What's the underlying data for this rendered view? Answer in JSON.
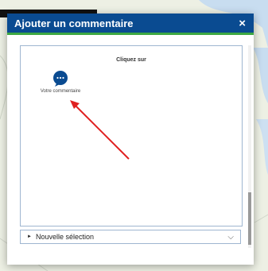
{
  "dialog": {
    "title": "Ajouter un commentaire",
    "close_symbol": "×"
  },
  "instruction": {
    "label": "Cliquez sur"
  },
  "comment_tool": {
    "label": "Votre commentaire",
    "icon": "comment-bubble-icon"
  },
  "selection": {
    "value": "Nouvelle sélection",
    "expand_icon": "chevron-down-icon"
  },
  "colors": {
    "header": "#0a4b91",
    "header_accent": "#3da843",
    "arrow": "#e02020"
  }
}
